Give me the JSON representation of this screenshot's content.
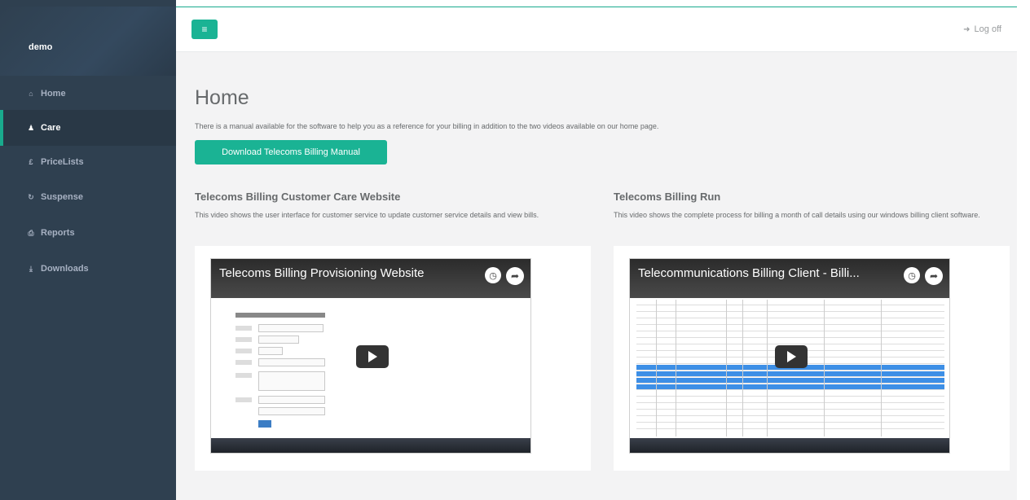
{
  "app": {
    "brand": "demo"
  },
  "sidebar": {
    "items": [
      {
        "label": "Home",
        "icon": "home-icon",
        "glyph": "⌂",
        "active": false
      },
      {
        "label": "Care",
        "icon": "user-icon",
        "glyph": "♟",
        "active": true
      },
      {
        "label": "PriceLists",
        "icon": "pound-icon",
        "glyph": "£",
        "active": false
      },
      {
        "label": "Suspense",
        "icon": "refresh-icon",
        "glyph": "↻",
        "active": false
      },
      {
        "label": "Reports",
        "icon": "print-icon",
        "glyph": "⎙",
        "active": false
      },
      {
        "label": "Downloads",
        "icon": "download-icon",
        "glyph": "⤓",
        "active": false
      }
    ]
  },
  "topbar": {
    "menu_glyph": "≡",
    "logoff_label": "Log off"
  },
  "main": {
    "title": "Home",
    "intro": "There is a manual available for the software to help you as a reference for your billing in addition to the two videos available on our home page.",
    "download_button": "Download Telecoms Billing Manual",
    "videos": [
      {
        "heading": "Telecoms Billing Customer Care Website",
        "description": "This video shows the user interface for customer service to update customer service details and view bills.",
        "player_title": "Telecoms Billing Provisioning Website"
      },
      {
        "heading": "Telecoms Billing Run",
        "description": "This video shows the complete process for billing a month of call details using our windows billing client software.",
        "player_title": "Telecommunications Billing Client - Billi..."
      }
    ]
  },
  "colors": {
    "accent": "#1ab394",
    "sidebar": "#2f4050",
    "background": "#f3f3f4"
  }
}
